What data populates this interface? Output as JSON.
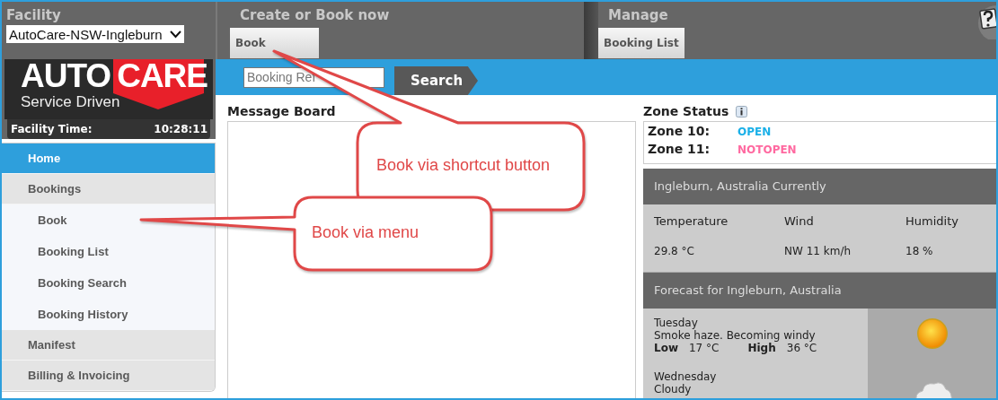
{
  "facility": {
    "label": "Facility",
    "value": "AutoCare-NSW-Ingleburn"
  },
  "logo": {
    "brand_left": "AUTO",
    "brand_right": "CARE",
    "tagline": "Service Driven"
  },
  "facility_time": {
    "label": "Facility Time:",
    "value": "10:28:11"
  },
  "sidebar": {
    "items": [
      {
        "label": "Home",
        "selected": true
      },
      {
        "label": "Bookings",
        "selected": false,
        "expanded": true,
        "children": [
          {
            "label": "Book",
            "selected": false
          },
          {
            "label": "Booking List",
            "selected": false
          },
          {
            "label": "Booking Search",
            "selected": false
          },
          {
            "label": "Booking History",
            "selected": false
          }
        ]
      },
      {
        "label": "Manifest",
        "selected": false
      },
      {
        "label": "Billing & Invoicing",
        "selected": false
      }
    ]
  },
  "toolbar": {
    "sections": [
      {
        "title": "Create or Book now",
        "buttons": [
          "Book"
        ]
      },
      {
        "title": "Manage",
        "buttons": [
          "Booking List"
        ]
      }
    ]
  },
  "search": {
    "placeholder": "Booking Ref",
    "button": "Search"
  },
  "message_board": {
    "title": "Message Board"
  },
  "zone_status": {
    "title": "Zone Status",
    "zones": [
      {
        "label": "Zone 10:",
        "status": "OPEN",
        "color": "#1ab0e8"
      },
      {
        "label": "Zone 11:",
        "status": "NOTOPEN",
        "color": "#ff69a0"
      }
    ]
  },
  "weather": {
    "current_title": "Ingleburn, Australia Currently",
    "columns": [
      {
        "label": "Temperature",
        "value": "29.8 °C"
      },
      {
        "label": "Wind",
        "value": "NW 11 km/h"
      },
      {
        "label": "Humidity",
        "value": "18 %"
      }
    ],
    "forecast_title": "Forecast for Ingleburn, Australia",
    "forecast": [
      {
        "day": "Tuesday",
        "summary": "Smoke haze. Becoming windy",
        "low_label": "Low",
        "low": "17 °C",
        "high_label": "High",
        "high": "36 °C"
      },
      {
        "day": "Wednesday",
        "summary": "Cloudy"
      }
    ]
  },
  "callouts": [
    {
      "text": "Book via shortcut button"
    },
    {
      "text": "Book via menu"
    }
  ]
}
